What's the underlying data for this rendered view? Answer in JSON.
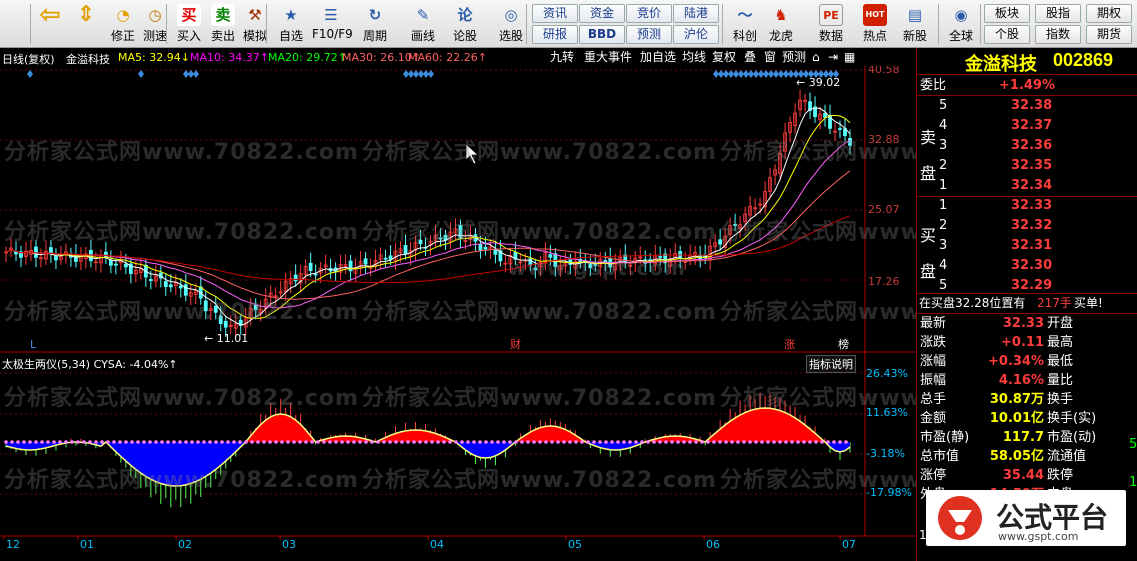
{
  "toolbar": {
    "buttons": [
      {
        "label": "",
        "icon": "back-arrow-icon"
      },
      {
        "label": "",
        "icon": "up-down-arrows-icon"
      },
      {
        "label": "修正",
        "icon": "clock-fix-icon"
      },
      {
        "label": "测速",
        "icon": "stopwatch-icon"
      },
      {
        "label": "买入",
        "icon": "buy-icon",
        "glyph": "买"
      },
      {
        "label": "卖出",
        "icon": "sell-icon",
        "glyph": "卖"
      },
      {
        "label": "模拟",
        "icon": "hammer-icon"
      },
      {
        "label": "自选",
        "icon": "star-folder-icon"
      },
      {
        "label": "F10/F9",
        "icon": "f10-icon"
      },
      {
        "label": "周期",
        "icon": "cycle-icon"
      },
      {
        "label": "画线",
        "icon": "pencil-icon"
      },
      {
        "label": "论股",
        "icon": "discuss-icon",
        "glyph": "论"
      },
      {
        "label": "选股",
        "icon": "select-stock-icon"
      },
      {
        "label": "科创",
        "icon": "kechuang-icon"
      },
      {
        "label": "龙虎",
        "icon": "dragon-tiger-icon"
      },
      {
        "label": "数据",
        "icon": "pe-data-icon",
        "glyph": "PE"
      },
      {
        "label": "热点",
        "icon": "hot-icon",
        "glyph": "HOT"
      },
      {
        "label": "新股",
        "icon": "new-stock-icon"
      },
      {
        "label": "全球",
        "icon": "globe-icon"
      }
    ],
    "small_buttons": [
      [
        "资讯",
        "资金",
        "竞价",
        "陆港"
      ],
      [
        "研报",
        "BBD",
        "预测",
        "沪伦"
      ]
    ],
    "right_buttons": [
      [
        "板块",
        "股指",
        "期权"
      ],
      [
        "个股",
        "指数",
        "期货"
      ]
    ]
  },
  "chart_header": {
    "mode": "日线(复权)",
    "stock": "金溢科技",
    "ma": [
      {
        "label": "MA5: 32.94↓",
        "color": "#ffffff"
      },
      {
        "label": "MA10: 34.37↑",
        "color": "#ffff00"
      },
      {
        "label": "MA20: 29.72↑",
        "color": "#ff00ff"
      },
      {
        "label": "MA30: 26.10↑",
        "color": "#00ff00"
      },
      {
        "label": "MA60: 22.26↑",
        "color": "#808080"
      }
    ],
    "buttons": [
      "九转",
      "重大事件",
      "加自选",
      "均线",
      "复权",
      "叠",
      "窗",
      "预测"
    ]
  },
  "price_axis": [
    "40.58",
    "32.88",
    "25.07",
    "17.26"
  ],
  "indicator": {
    "title": "太极生两仪(5,34)",
    "cysa": "CYSA: -4.04%↑",
    "explain": "指标说明",
    "axis": [
      "26.43%",
      "11.63%",
      "-3.18%",
      "-17.98%"
    ]
  },
  "annotations": {
    "high": "← 39.02",
    "low": "← 11.01",
    "mark_l": "L",
    "mark_cai": "财",
    "mark_zhang": "涨",
    "mark_bang": "榜"
  },
  "date_axis": [
    "12",
    "01",
    "02",
    "03",
    "04",
    "05",
    "06",
    "07"
  ],
  "watermarks": [
    "分析家公式网www.70822.com",
    "www.gspt.com"
  ],
  "right_panel": {
    "name": "金溢科技",
    "code": "002869",
    "webi_label": "委比",
    "webi_value": "+1.49%",
    "sell_label": "卖盘",
    "sell": [
      {
        "n": "5",
        "p": "32.38"
      },
      {
        "n": "4",
        "p": "32.37"
      },
      {
        "n": "3",
        "p": "32.36"
      },
      {
        "n": "2",
        "p": "32.35"
      },
      {
        "n": "1",
        "p": "32.34"
      }
    ],
    "buy_label": "买盘",
    "buy": [
      {
        "n": "1",
        "p": "32.33"
      },
      {
        "n": "2",
        "p": "32.32"
      },
      {
        "n": "3",
        "p": "32.31"
      },
      {
        "n": "4",
        "p": "32.30"
      },
      {
        "n": "5",
        "p": "32.29"
      }
    ],
    "status": "在买盘32.28位置有",
    "status_vol": "217手",
    "status_tag": "买单!",
    "quote": [
      {
        "l": "最新",
        "v": "32.33",
        "l2": "开盘"
      },
      {
        "l": "涨跌",
        "v": "+0.11",
        "l2": "最高"
      },
      {
        "l": "涨幅",
        "v": "+0.34%",
        "l2": "最低"
      },
      {
        "l": "振幅",
        "v": "4.16%",
        "l2": "量比"
      },
      {
        "l": "总手",
        "v": "30.87万",
        "l2": "换手"
      },
      {
        "l": "金额",
        "v": "10.01亿",
        "l2": "换手(实)"
      },
      {
        "l": "市盈(静)",
        "v": "117.7",
        "l2": "市盈(动)"
      },
      {
        "l": "总市值",
        "v": "58.05亿",
        "l2": "流通值"
      },
      {
        "l": "涨停",
        "v": "35.44",
        "l2": "跌停"
      },
      {
        "l": "外盘",
        "v": "14.59万",
        "l2": "内盘"
      }
    ],
    "row_tail": "5",
    "row_tail2": "1",
    "bottom_digit": "1"
  },
  "brand": {
    "name": "公式平台",
    "url": "www.gspt.com"
  }
}
